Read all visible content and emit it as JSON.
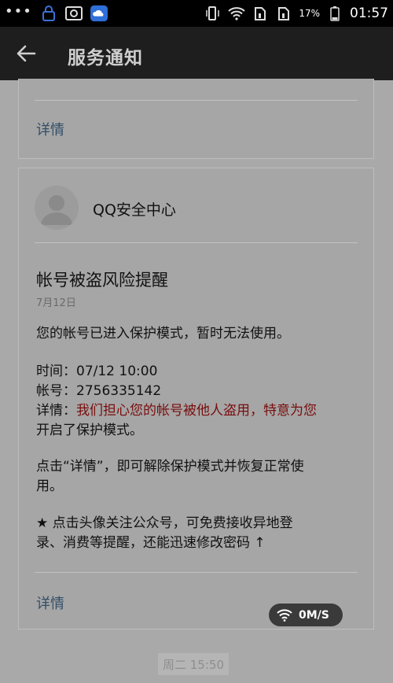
{
  "status_bar": {
    "battery_percent": "17%",
    "time": "01:57"
  },
  "header": {
    "title": "服务通知"
  },
  "card1": {
    "detail_label": "详情"
  },
  "card2": {
    "sender": "QQ安全中心",
    "message_title": "帐号被盗风险提醒",
    "date": "7月12日",
    "warning": "您的帐号已进入保护模式，暂时无法使用。",
    "time_label": "时间：",
    "time_value": "07/12 10:00",
    "account_label": "帐号：",
    "account_value": "2756335142",
    "detail_prefix": "详情：",
    "detail_red_1": "我们担心您的帐号被他人盗用，特意为您",
    "detail_red_2": "开启了保护模式。",
    "instruction_1": "点击“详情”，即可解除保护模式并恢复正常使",
    "instruction_2": "用。",
    "tip_1": "★ 点击头像关注公众号，可免费接收异地登",
    "tip_2": "录、消费等提醒，还能迅速修改密码 ↑",
    "detail_label": "详情"
  },
  "network_speed": "0M/S",
  "bottom_timestamp": "周二 15:50"
}
